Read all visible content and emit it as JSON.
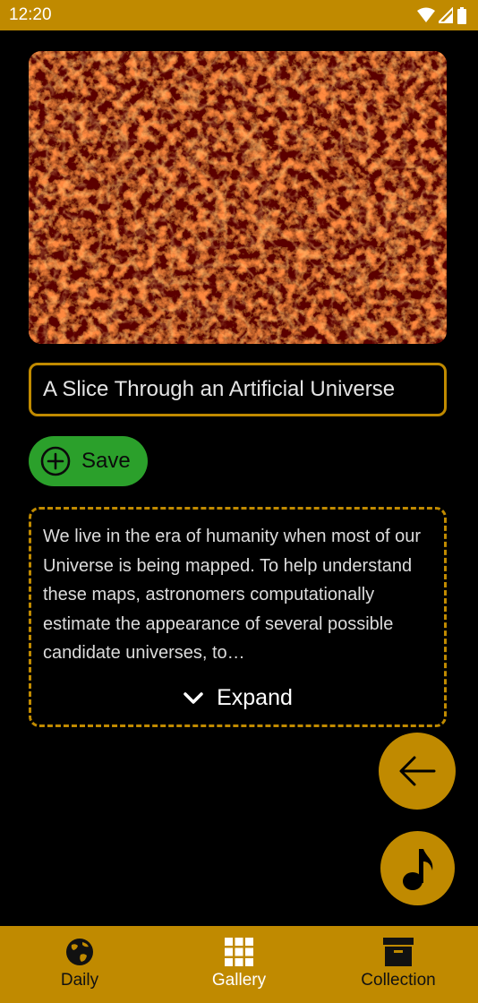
{
  "status_bar": {
    "time": "12:20"
  },
  "apod": {
    "title": "A Slice Through an Artificial Universe",
    "save_label": "Save",
    "description": "We live in the era of humanity when most of our Universe is being mapped. To help understand these maps, astronomers computationally estimate the appearance of several possible candidate universes, to…",
    "expand_label": "Expand"
  },
  "nav": {
    "items": [
      {
        "label": "Daily",
        "icon": "globe-icon"
      },
      {
        "label": "Gallery",
        "icon": "grid-icon"
      },
      {
        "label": "Collection",
        "icon": "archive-icon"
      }
    ]
  },
  "colors": {
    "accent": "#c08a00",
    "save": "#2ba02b",
    "background": "#000000"
  }
}
